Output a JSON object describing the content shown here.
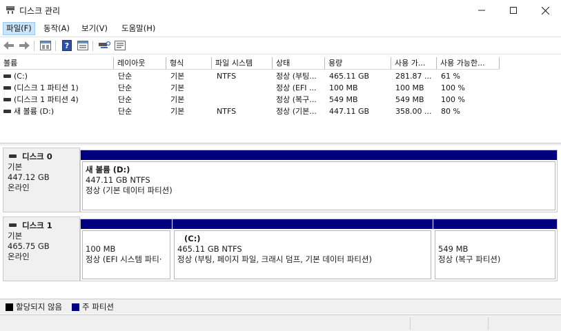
{
  "window": {
    "title": "디스크 관리",
    "minimize_icon": "minimize-icon",
    "maximize_icon": "maximize-icon",
    "close_icon": "close-icon"
  },
  "menu": [
    "파일(F)",
    "동작(A)",
    "보기(V)",
    "도움말(H)"
  ],
  "toolbar": [
    "back-icon",
    "forward-icon",
    "properties-icon",
    "help-icon",
    "volume-list-icon",
    "rescan-icon",
    "refresh-icon"
  ],
  "volume_list": {
    "columns": [
      "볼륨",
      "레이아웃",
      "형식",
      "파일 시스템",
      "상태",
      "용량",
      "사용 가...",
      "사용 가능한..."
    ],
    "rows": [
      [
        "(C:)",
        "단순",
        "기본",
        "NTFS",
        "정상 (부팅...",
        "465.11 GB",
        "281.87 ...",
        "61 %"
      ],
      [
        "(디스크 1 파티션 1)",
        "단순",
        "기본",
        "",
        "정상 (EFI ...",
        "100 MB",
        "100 MB",
        "100 %"
      ],
      [
        "(디스크 1 파티션 4)",
        "단순",
        "기본",
        "",
        "정상 (복구...",
        "549 MB",
        "549 MB",
        "100 %"
      ],
      [
        "새 볼륨 (D:)",
        "단순",
        "기본",
        "NTFS",
        "정상 (기본...",
        "447.11 GB",
        "358.00 ...",
        "80 %"
      ]
    ]
  },
  "disks": [
    {
      "name": "디스크 0",
      "type": "기본",
      "size": "447.12 GB",
      "status": "온라인",
      "partitions": [
        {
          "name": "새 볼륨  (D:)",
          "size": "447.11 GB NTFS",
          "state": "정상 (기본 데이터 파티션)"
        }
      ]
    },
    {
      "name": "디스크 1",
      "type": "기본",
      "size": "465.75 GB",
      "status": "온라인",
      "partitions": [
        {
          "name": "",
          "size": "100 MB",
          "state": "정상 (EFI 시스템 파티·"
        },
        {
          "name": "(C:)",
          "size": "465.11 GB NTFS",
          "state": "정상 (부팅, 페이지 파일, 크래시 덤프, 기본 데이터 파티션)"
        },
        {
          "name": "",
          "size": "549 MB",
          "state": "정상 (복구 파티션)"
        }
      ]
    }
  ],
  "legend": [
    {
      "label": "할당되지 않음",
      "color": "#000000"
    },
    {
      "label": "주 파티션",
      "color": "#00007f"
    }
  ],
  "colors": {
    "primary_partition": "#00007f",
    "menu_highlight": "#cce4f7"
  }
}
